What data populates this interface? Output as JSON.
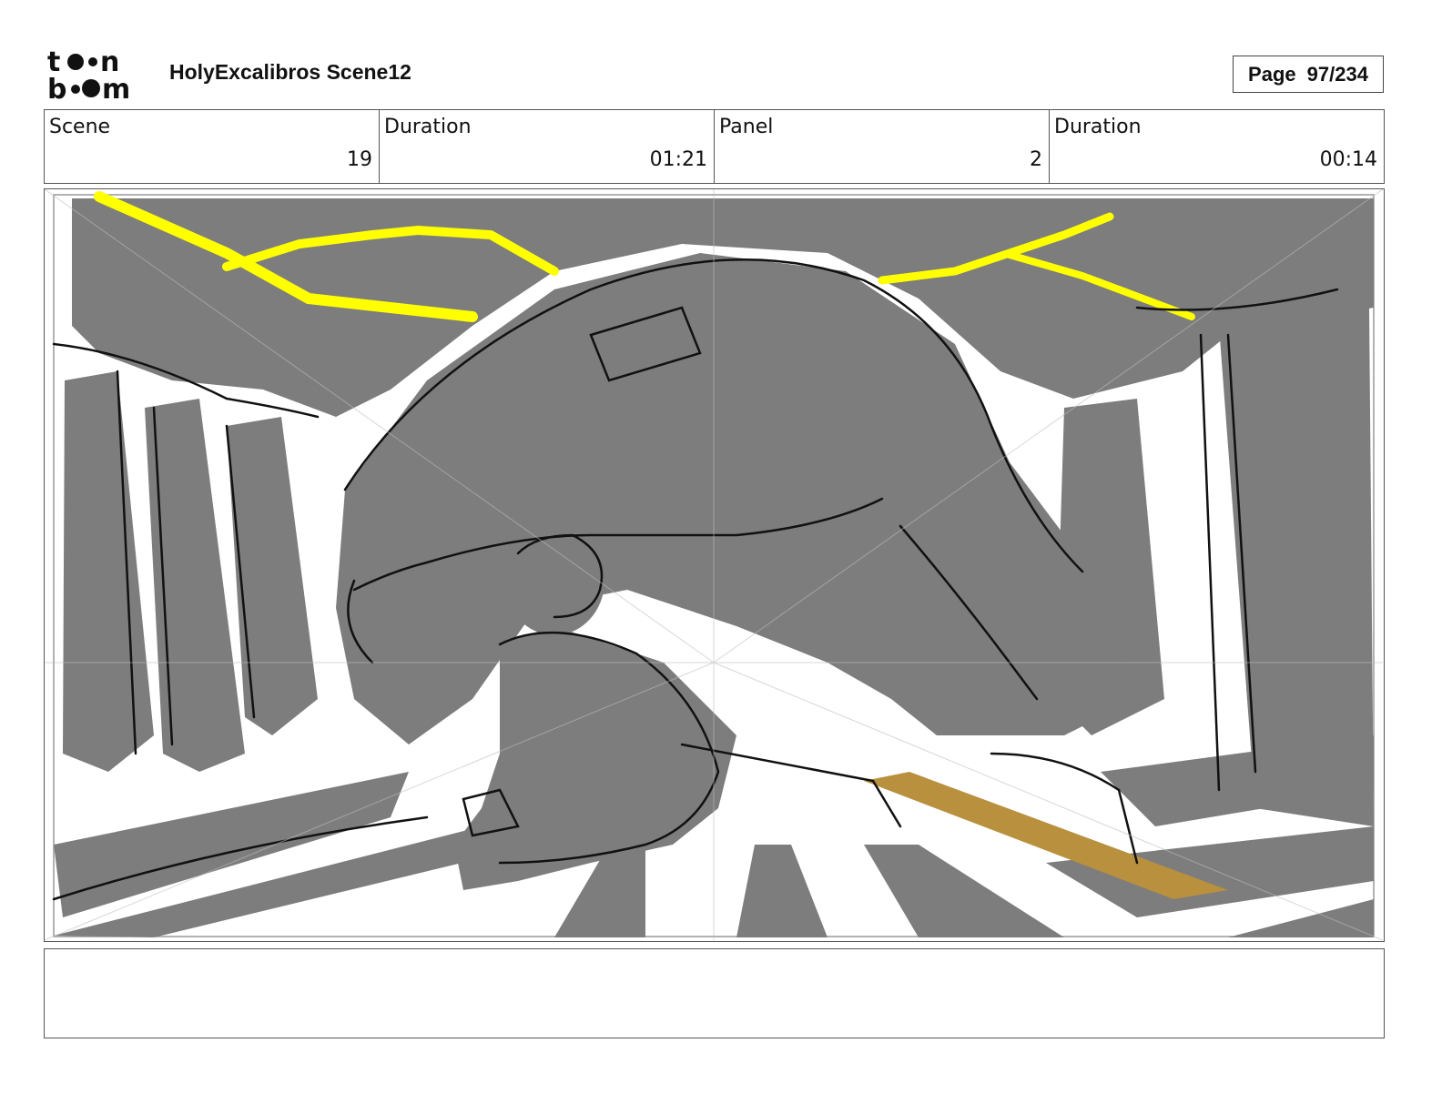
{
  "header": {
    "logo_text": "toon boom",
    "title": "HolyExcalibros Scene12",
    "page_label": "Page",
    "page_value": "97/234"
  },
  "info": [
    {
      "label": "Scene",
      "value": "19"
    },
    {
      "label": "Duration",
      "value": "01:21"
    },
    {
      "label": "Panel",
      "value": "2"
    },
    {
      "label": "Duration",
      "value": "00:14"
    }
  ],
  "panel": {
    "image": "storyboard-sketch-giant-and-kneeling-hero",
    "colors": {
      "shade": "#7d7d7d",
      "lightning": "#ffff00",
      "sword": "#b8903e",
      "ink": "#111111"
    }
  },
  "notes": {
    "text": ""
  }
}
